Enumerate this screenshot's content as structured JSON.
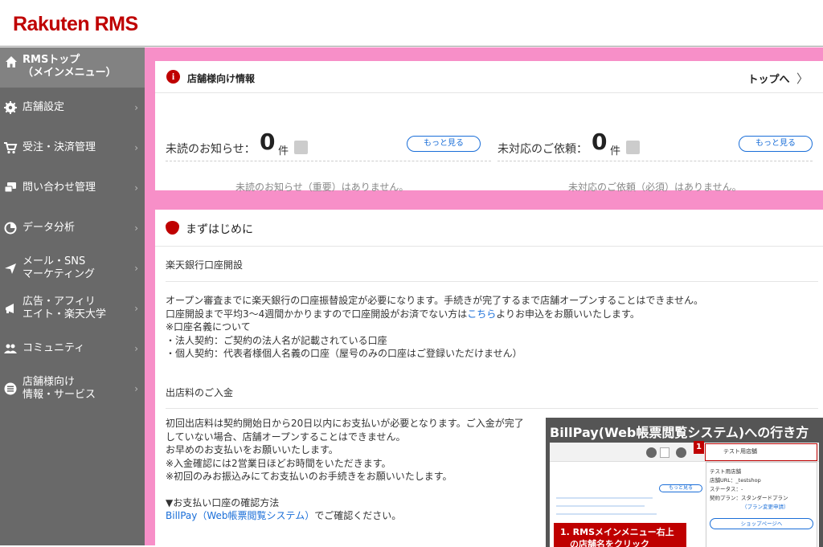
{
  "header": {
    "logo": "Rakuten RMS"
  },
  "sidebar": {
    "top": {
      "line1": "RMSトップ",
      "line2": "（メインメニュー）"
    },
    "items": [
      {
        "line1": "店舗設定",
        "line2": "",
        "icon": "gear-icon"
      },
      {
        "line1": "受注・決済管理",
        "line2": "",
        "icon": "cart-icon"
      },
      {
        "line1": "問い合わせ管理",
        "line2": "",
        "icon": "message-icon"
      },
      {
        "line1": "データ分析",
        "line2": "",
        "icon": "chart-icon"
      },
      {
        "line1": "メール・SNS",
        "line2": "マーケティング",
        "icon": "send-icon"
      },
      {
        "line1": "広告・アフィリ",
        "line2": "エイト・楽天大学",
        "icon": "megaphone-icon"
      },
      {
        "line1": "コミュニティ",
        "line2": "",
        "icon": "community-icon"
      },
      {
        "line1": "店舗様向け",
        "line2": "情報・サービス",
        "icon": "list-icon"
      }
    ]
  },
  "notice": {
    "title": "店舗様向け情報",
    "top_link": "トップへ",
    "unread": {
      "label": "未読のお知らせ：",
      "count": "0",
      "unit": "件",
      "more": "もっと見る",
      "empty": "未読のお知らせ（重要）はありません。"
    },
    "pending": {
      "label": "未対応のご依頼：",
      "count": "0",
      "unit": "件",
      "more": "もっと見る",
      "empty": "未対応のご依頼（必須）はありません。"
    }
  },
  "start": {
    "title": "まずはじめに",
    "section1": {
      "heading": "楽天銀行口座開設",
      "lines": [
        "オープン審査までに楽天銀行の口座振替設定が必要になります。手続きが完了するまで店舗オープンすることはできません。",
        "口座開設まで平均3〜4週間かかりますので口座開設がお済でない方は",
        "こちら",
        "よりお申込をお願いいたします。",
        "※口座名義について",
        "・法人契約：ご契約の法人名が記載されている口座",
        "・個人契約：代表者様個人名義の口座（屋号のみの口座はご登録いただけません）"
      ]
    },
    "section2": {
      "heading": "出店料のご入金",
      "lines": [
        "初回出店料は契約開始日から20日以内にお支払いが必要となります。ご入金が完了",
        "していない場合、店舗オープンすることはできません。",
        "お早めのお支払いをお願いいたします。",
        "※入金確認には2営業日ほどお時間をいただきます。",
        "※初回のみお振込みにてお支払いのお手続きをお願いいたします。",
        "▼お支払い口座の確認方法",
        "BillPay（Web帳票閲覧システム）",
        "でご確認ください。"
      ]
    },
    "billpay": {
      "title": "BillPay(Web帳票閲覧システム)への行き方",
      "step_number": "1",
      "shop_name": "テスト用店舗",
      "panel_title": "テスト用店舗",
      "panel_url": "店舗URL：_testshop",
      "panel_status": "ステータス：-",
      "panel_plan": "契約プラン：スタンダードプラン",
      "panel_plan_link": "（プラン変更申請）",
      "panel_button": "ショップページへ",
      "more_small": "もっと見る",
      "step_caption_1": "1. RMSメインメニュー右上",
      "step_caption_2": "の店舗名をクリック"
    }
  }
}
